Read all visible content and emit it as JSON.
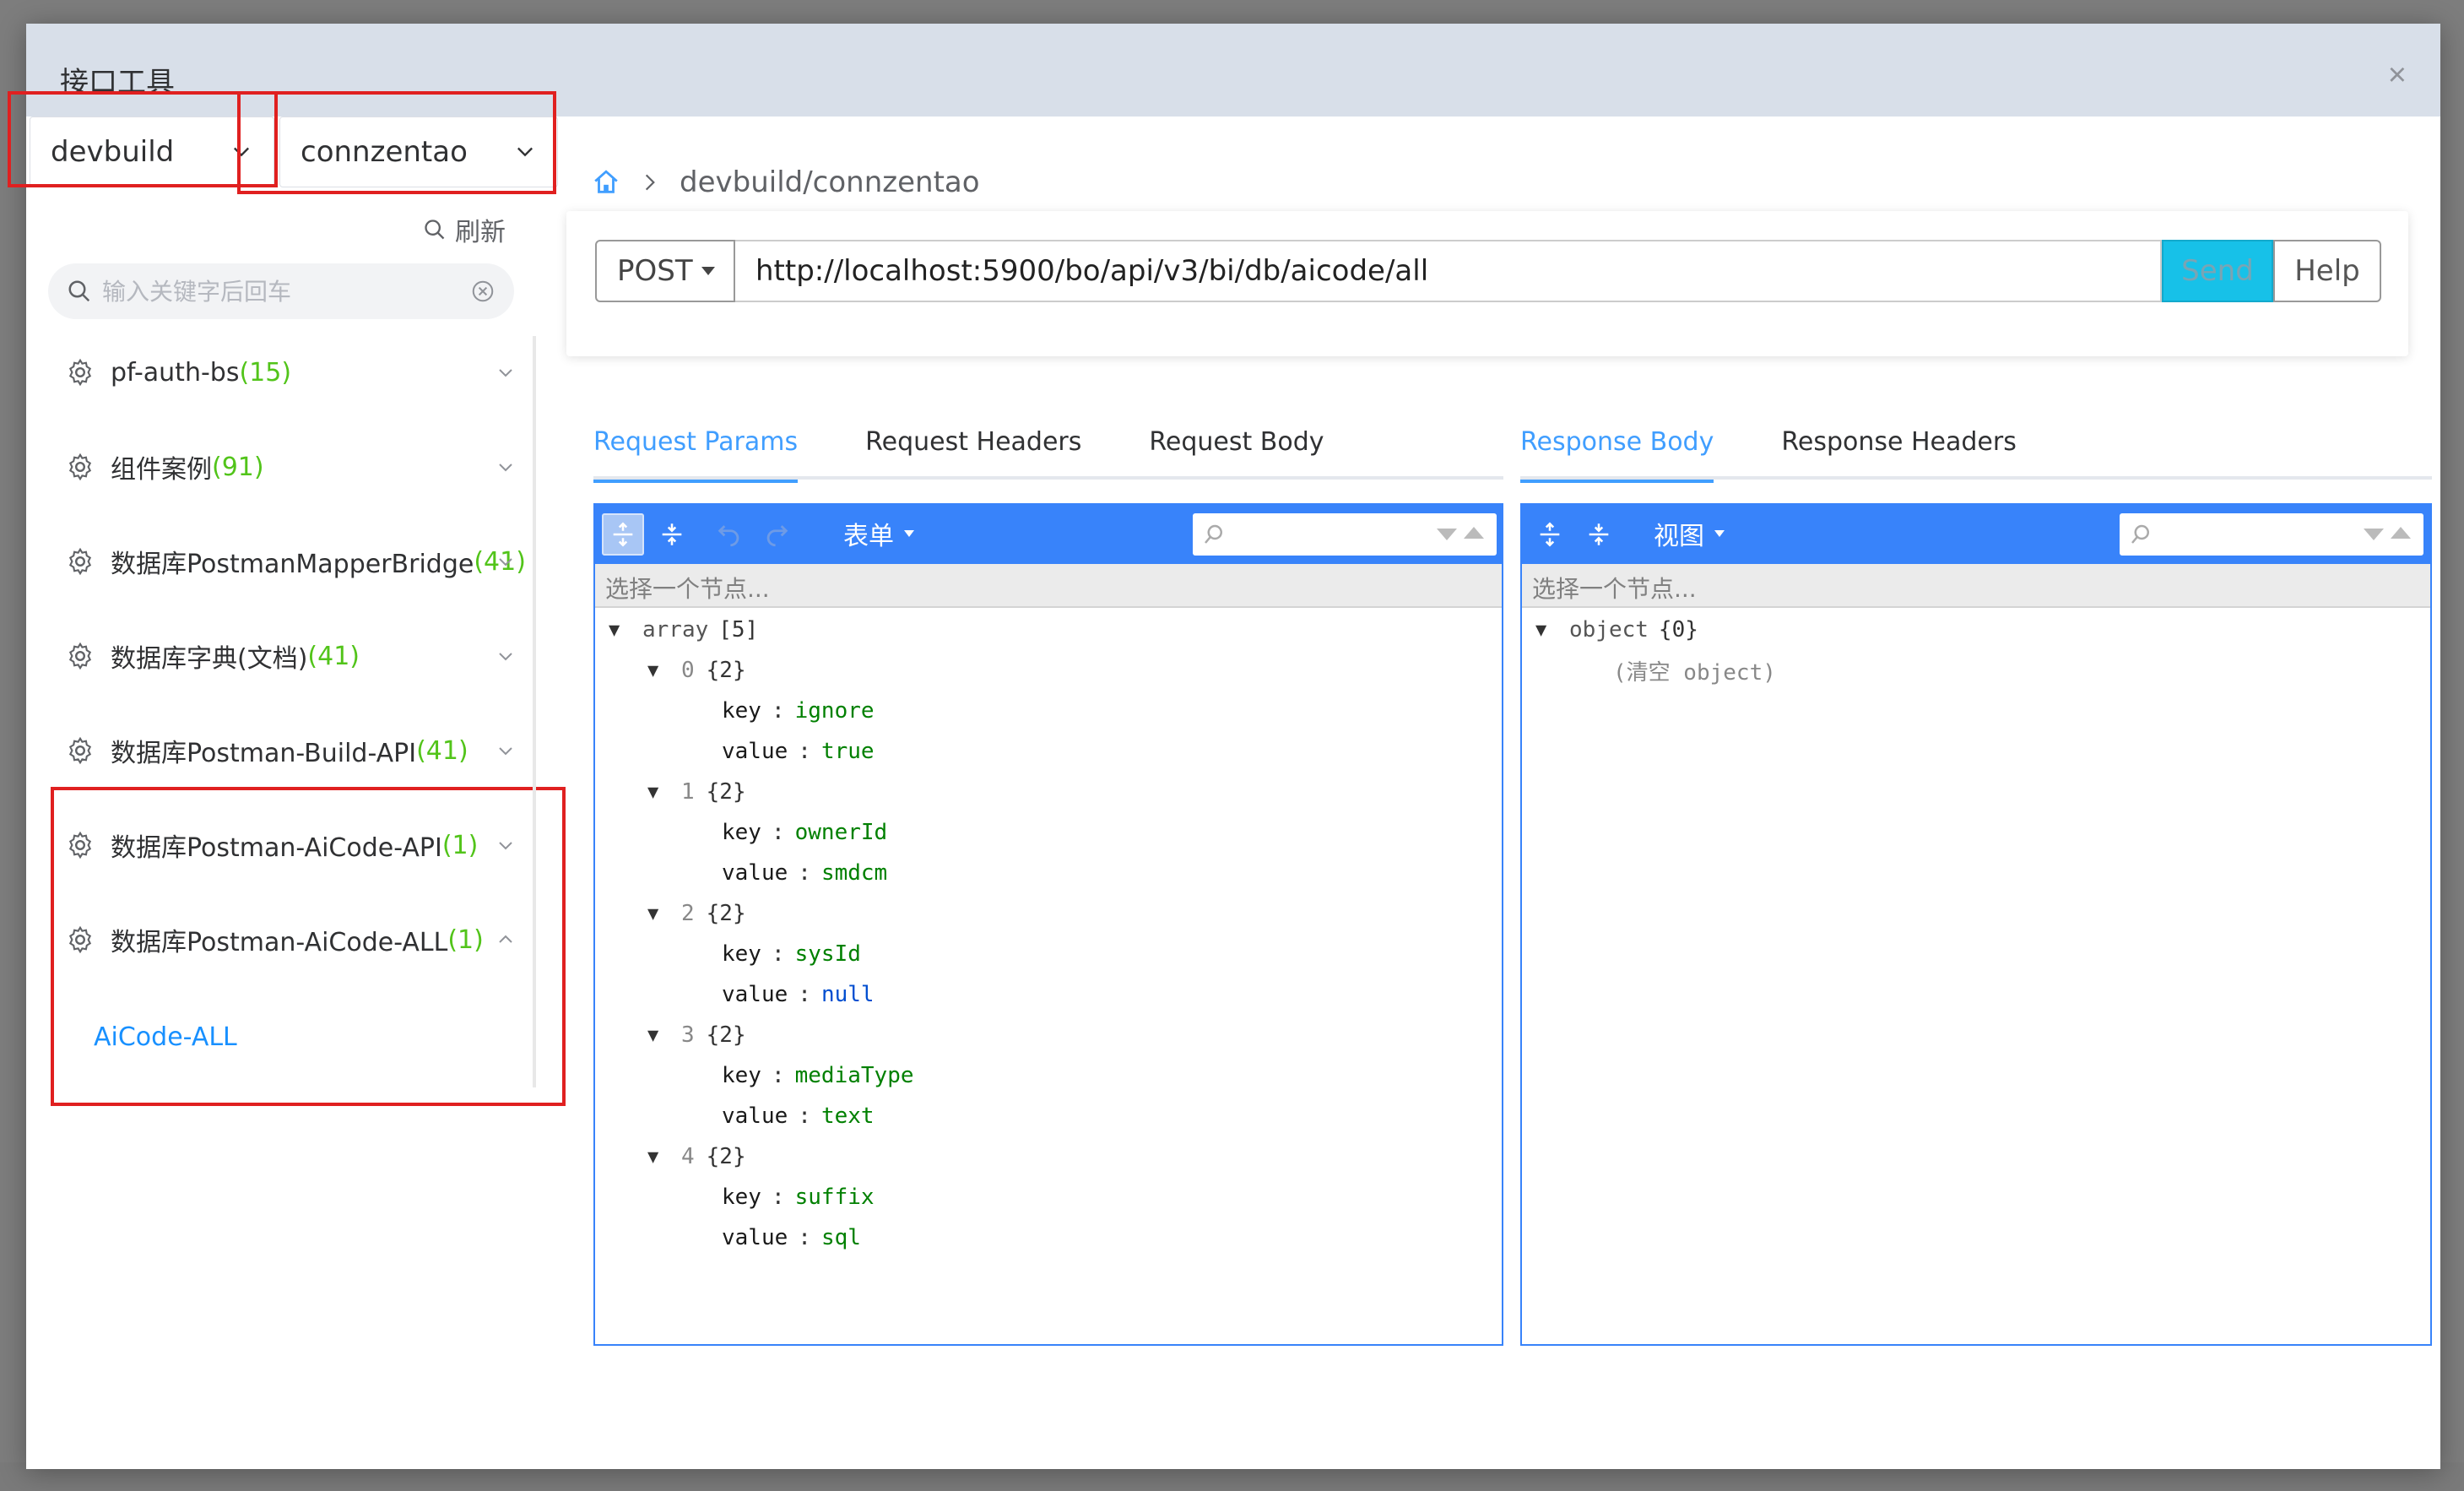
{
  "dialog": {
    "title": "接口工具",
    "close": "×"
  },
  "selectors": {
    "env": "devbuild",
    "project": "connzentao"
  },
  "sidebar": {
    "refresh_label": "刷新",
    "search_placeholder": "输入关键字后回车",
    "groups": [
      {
        "name": "pf-auth-bs",
        "count": "(15)",
        "expanded": false
      },
      {
        "name": "组件案例",
        "count": "(91)",
        "expanded": false
      },
      {
        "name": "数据库PostmanMapperBridge",
        "count": "(41)",
        "expanded": false
      },
      {
        "name": "数据库字典(文档)",
        "count": "(41)",
        "expanded": false
      },
      {
        "name": "数据库Postman-Build-API",
        "count": "(41)",
        "expanded": false
      },
      {
        "name": "数据库Postman-AiCode-API",
        "count": "(1)",
        "expanded": false
      },
      {
        "name": "数据库Postman-AiCode-ALL",
        "count": "(1)",
        "expanded": true
      }
    ],
    "leaf": "AiCode-ALL"
  },
  "breadcrumb": {
    "path": "devbuild/connzentao"
  },
  "request": {
    "method": "POST",
    "url": "http://localhost:5900/bo/api/v3/bi/db/aicode/all",
    "send_label": "Send",
    "help_label": "Help"
  },
  "tabs_left": [
    "Request Params",
    "Request Headers",
    "Request Body"
  ],
  "tabs_right": [
    "Response Body",
    "Response Headers"
  ],
  "editor_left": {
    "mode": "表单",
    "path": "选择一个节点...",
    "root_type": "array",
    "root_count": "[5]",
    "items": [
      {
        "index": "0",
        "count": "{2}",
        "key": "ignore",
        "value": "true",
        "value_type": "string"
      },
      {
        "index": "1",
        "count": "{2}",
        "key": "ownerId",
        "value": "smdcm",
        "value_type": "string"
      },
      {
        "index": "2",
        "count": "{2}",
        "key": "sysId",
        "value": "null",
        "value_type": "null"
      },
      {
        "index": "3",
        "count": "{2}",
        "key": "mediaType",
        "value": "text",
        "value_type": "string"
      },
      {
        "index": "4",
        "count": "{2}",
        "key": "suffix",
        "value": "sql",
        "value_type": "string"
      }
    ],
    "key_label": "key",
    "value_label": "value"
  },
  "editor_right": {
    "mode": "视图",
    "path": "选择一个节点...",
    "root_type": "object",
    "root_count": "{0}",
    "empty": "(清空 object)"
  },
  "colors": {
    "accent": "#409eff",
    "editor": "#3883fa",
    "send": "#17c1e8",
    "count": "#52c41a",
    "highlight": "#e02020"
  }
}
